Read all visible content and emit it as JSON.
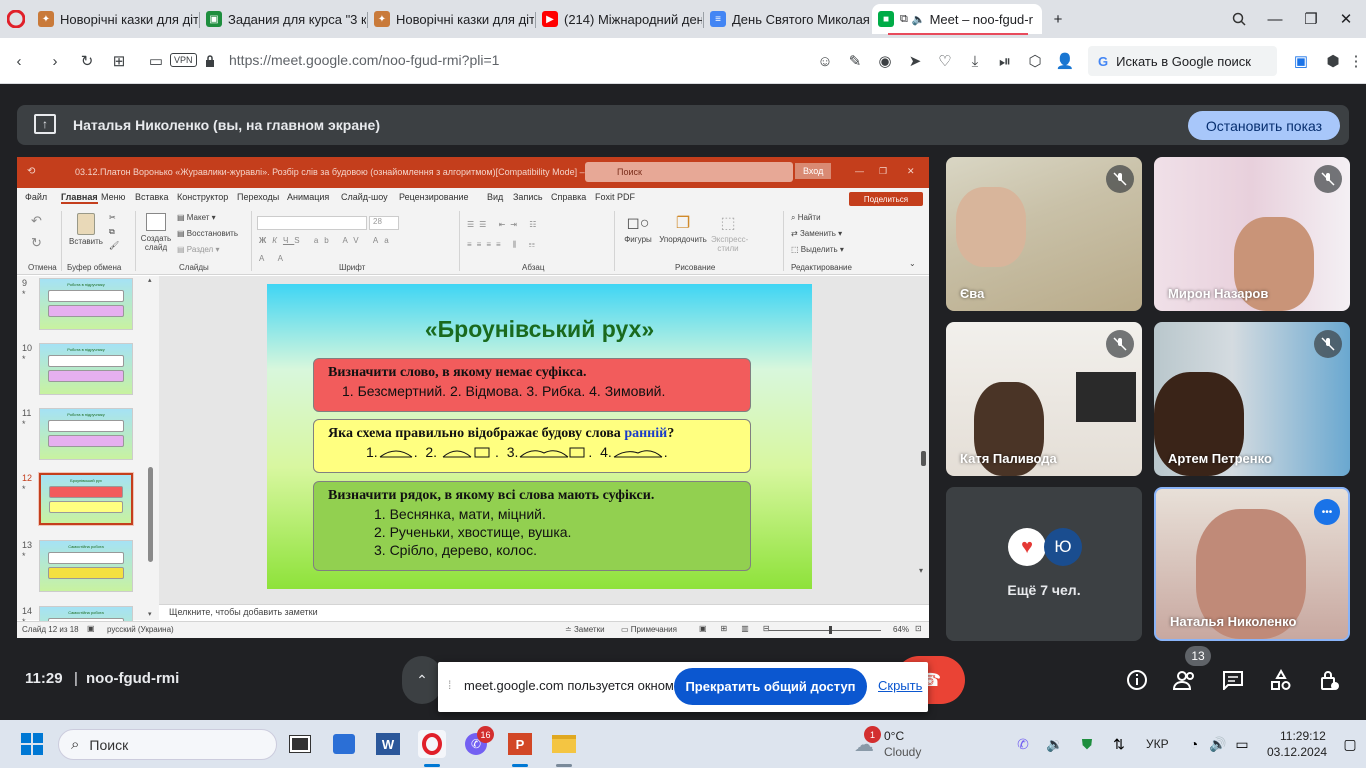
{
  "browser": {
    "tabs": [
      {
        "title": "Новорічні казки для дітей",
        "icon": "book-icon"
      },
      {
        "title": "Задания для курса \"3 кла",
        "icon": "classroom-icon"
      },
      {
        "title": "Новорічні казки для дітей",
        "icon": "book-icon"
      },
      {
        "title": "(214) Міжнародний день",
        "icon": "youtube-icon"
      },
      {
        "title": "День Святого Миколая.d",
        "icon": "docs-icon"
      },
      {
        "title": "Meet – noo-fgud-r",
        "icon": "meet-icon"
      }
    ],
    "new_tab_label": "+",
    "url": "https://meet.google.com/noo-fgud-rmi?pli=1",
    "vpn_label": "VPN",
    "google_search_label": "Искать в Google поиск"
  },
  "meet": {
    "presenting_label": "Наталья Николенко (вы, на главном экране)",
    "stop_presenting_label": "Остановить показ",
    "time": "11:29",
    "meeting_code": "noo-fgud-rmi",
    "people_count": "13",
    "participants": [
      {
        "name": "Єва",
        "muted": true
      },
      {
        "name": "Мирон Назаров",
        "muted": true
      },
      {
        "name": "Катя Паливода",
        "muted": true
      },
      {
        "name": "Артем Петренко",
        "muted": true
      },
      {
        "name": "Ещё 7 чел.",
        "avatar_letter": "Ю"
      },
      {
        "name": "Наталья Николенко",
        "more_label": "•••"
      }
    ],
    "share_popup": {
      "message": "meet.google.com пользуется окном.",
      "stop_label": "Прекратить общий доступ",
      "hide_label": "Скрыть"
    }
  },
  "ppt": {
    "title": "03.12.Платон Воронько «Журавлики-журавлі». Розбір слів за будовою (ознайомлення з алгоритмом)[Compatibility Mode] – PowerPoint",
    "search_placeholder": "Поиск",
    "signin_label": "Вход",
    "menu": [
      "Файл",
      "Главная",
      "Меню",
      "Вставка",
      "Конструктор",
      "Переходы",
      "Анимация",
      "Слайд-шоу",
      "Рецензирование",
      "Вид",
      "Запись",
      "Справка",
      "Foxit PDF"
    ],
    "share_label": "Поделиться",
    "ribbon": {
      "undo_group": "Отмена",
      "paste_label": "Вставить",
      "clipboard_group": "Буфер обмена",
      "new_slide_label": "Создать слайд",
      "layout_label": "Макет",
      "reset_label": "Восстановить",
      "section_label": "Раздел",
      "slides_group": "Слайды",
      "font_group": "Шрифт",
      "font_size": "28",
      "paragraph_group": "Абзац",
      "shapes_label": "Фигуры",
      "arrange_label": "Упорядочить",
      "quick_styles_label": "Экспресс-стили",
      "drawing_group": "Рисование",
      "find_label": "Найти",
      "replace_label": "Заменить",
      "select_label": "Выделить",
      "editing_group": "Редактирование"
    },
    "thumbnails": [
      {
        "num": "9",
        "title": "Робота в підручнику"
      },
      {
        "num": "10",
        "title": "Робота в підручнику"
      },
      {
        "num": "11",
        "title": "Робота в підручнику"
      },
      {
        "num": "12",
        "title": "Броунівський рух"
      },
      {
        "num": "13",
        "title": "Самостійна робота"
      },
      {
        "num": "14",
        "title": "Самостійна робота"
      }
    ],
    "slide": {
      "title": "«Броунівський рух»",
      "q1": "Визначити слово, в якому немає суфікса.",
      "a1": "1. Безсмертний.  2. Відмова.  3. Рибка.  4. Зимовий.",
      "q2_prefix": "Яка схема правильно відображає будову слова ",
      "q2_word": "ранній",
      "q2_suffix": "?",
      "a2": [
        "1.",
        ".  2.",
        ".  3.",
        ".  4.",
        "."
      ],
      "q3": "Визначити рядок, в якому всі слова мають суфікси.",
      "a3": [
        "1.  Веснянка, мати, міцний.",
        "2.  Рученьки, хвостище, вушка.",
        "3.  Срібло, дерево, колос."
      ]
    },
    "notes_placeholder": "Щелкните, чтобы добавить заметки",
    "status": {
      "slide_counter": "Слайд 12 из 18",
      "language": "русский (Украина)",
      "notes_label": "Заметки",
      "comments_label": "Примечания",
      "zoom": "64%"
    },
    "colors": {
      "red_box": "#f25c5c",
      "yellow_box": "#ffff80",
      "green_box": "#92d050",
      "title_bar": "#c43e1c"
    }
  },
  "taskbar": {
    "search_label": "Поиск",
    "viber_badge": "16",
    "weather_badge": "1",
    "temperature": "0°C",
    "weather": "Cloudy",
    "language": "УКР",
    "time": "11:29:12",
    "date": "03.12.2024"
  }
}
